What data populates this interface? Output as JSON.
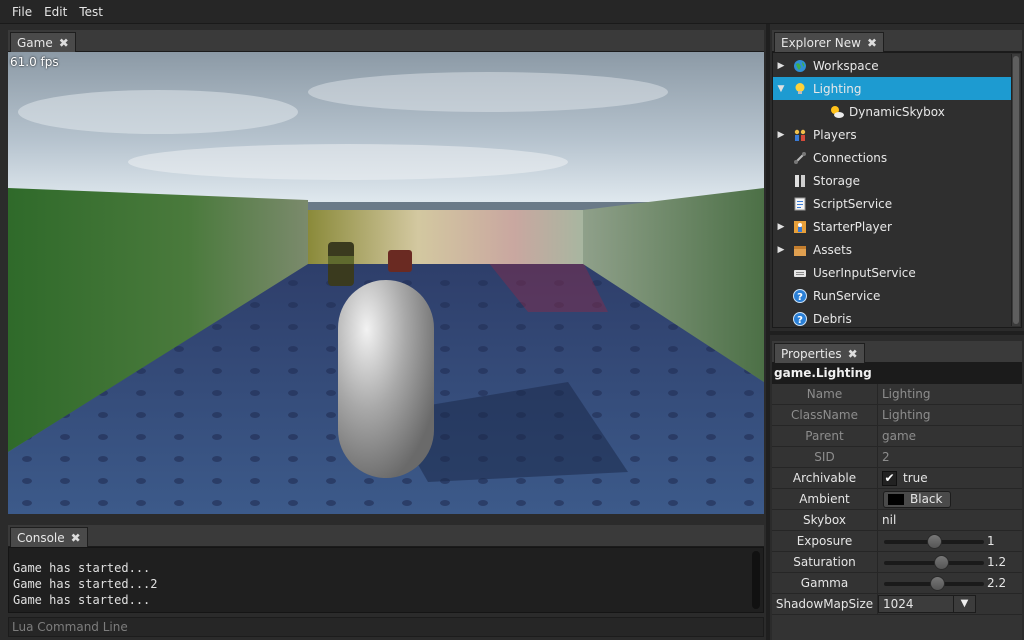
{
  "menu": {
    "items": [
      "File",
      "Edit",
      "Test"
    ]
  },
  "game": {
    "tab_label": "Game",
    "close_glyph": "✖",
    "fps": "61.0 fps"
  },
  "console": {
    "tab_label": "Console",
    "close_glyph": "✖",
    "lines": [
      "Game has started...",
      "Game has started...2",
      "Game has started..."
    ],
    "lua_placeholder": "Lua Command Line"
  },
  "explorer": {
    "tab_label": "Explorer New",
    "close_glyph": "✖",
    "items": [
      {
        "label": "Workspace",
        "icon": "globe-icon",
        "expander": "▶",
        "selected": false,
        "indent": 0
      },
      {
        "label": "Lighting",
        "icon": "lightbulb-icon",
        "expander": "▼",
        "selected": true,
        "indent": 0
      },
      {
        "label": "DynamicSkybox",
        "icon": "sun-cloud-icon",
        "expander": "",
        "selected": false,
        "indent": 1
      },
      {
        "label": "Players",
        "icon": "players-icon",
        "expander": "▶",
        "selected": false,
        "indent": 0
      },
      {
        "label": "Connections",
        "icon": "connection-icon",
        "expander": "",
        "selected": false,
        "indent": 0
      },
      {
        "label": "Storage",
        "icon": "storage-icon",
        "expander": "",
        "selected": false,
        "indent": 0
      },
      {
        "label": "ScriptService",
        "icon": "script-icon",
        "expander": "",
        "selected": false,
        "indent": 0
      },
      {
        "label": "StarterPlayer",
        "icon": "starter-player-icon",
        "expander": "▶",
        "selected": false,
        "indent": 0
      },
      {
        "label": "Assets",
        "icon": "box-icon",
        "expander": "▶",
        "selected": false,
        "indent": 0
      },
      {
        "label": "UserInputService",
        "icon": "keyboard-icon",
        "expander": "",
        "selected": false,
        "indent": 0
      },
      {
        "label": "RunService",
        "icon": "question-icon",
        "expander": "",
        "selected": false,
        "indent": 0
      },
      {
        "label": "Debris",
        "icon": "question-icon",
        "expander": "",
        "selected": false,
        "indent": 0
      }
    ]
  },
  "properties": {
    "tab_label": "Properties",
    "close_glyph": "✖",
    "header": "game.Lighting",
    "name": {
      "label": "Name",
      "value": "Lighting"
    },
    "classname": {
      "label": "ClassName",
      "value": "Lighting"
    },
    "parent": {
      "label": "Parent",
      "value": "game"
    },
    "sid": {
      "label": "SID",
      "value": "2"
    },
    "archivable": {
      "label": "Archivable",
      "checked": true,
      "check_glyph": "✔",
      "value": "true"
    },
    "ambient": {
      "label": "Ambient",
      "value": "Black",
      "swatch_color": "#000000"
    },
    "skybox": {
      "label": "Skybox",
      "value": "nil"
    },
    "exposure": {
      "label": "Exposure",
      "value": "1",
      "fraction": 0.5
    },
    "saturation": {
      "label": "Saturation",
      "value": "1.2",
      "fraction": 0.57
    },
    "gamma": {
      "label": "Gamma",
      "value": "2.2",
      "fraction": 0.53
    },
    "shadowmapsize": {
      "label": "ShadowMapSize",
      "value": "1024",
      "dropdown_glyph": "▼"
    }
  },
  "colors": {
    "selection": "#1d9bd1",
    "panel_bg": "#2f2f2f",
    "tab_bg": "#4a4a4a"
  }
}
